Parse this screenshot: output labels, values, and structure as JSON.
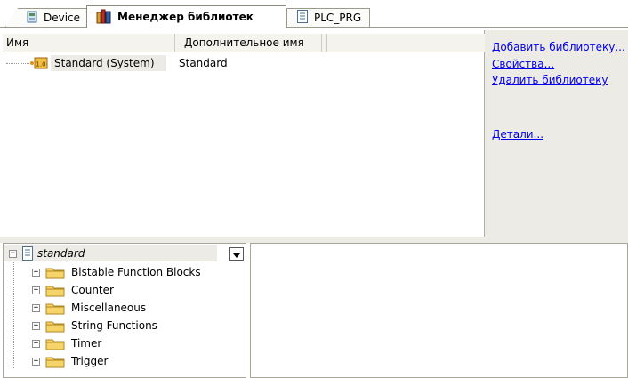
{
  "tabs": [
    {
      "label": "Device",
      "icon": "device-icon"
    },
    {
      "label": "Менеджер библиотек",
      "icon": "library-manager-icon"
    },
    {
      "label": "PLC_PRG",
      "icon": "document-icon"
    }
  ],
  "library_table": {
    "columns": [
      "Имя",
      "Дополнительное имя"
    ],
    "rows": [
      {
        "name": "Standard (System)",
        "alt_name": "Standard"
      }
    ]
  },
  "actions": {
    "add": "Добавить библиотеку...",
    "properties": "Свойства...",
    "delete": "Удалить библиотеку",
    "details": "Детали..."
  },
  "tree": {
    "root": "standard",
    "items": [
      "Bistable Function Blocks",
      "Counter",
      "Miscellaneous",
      "String Functions",
      "Timer",
      "Trigger"
    ]
  },
  "colors": {
    "link": "#0000ee",
    "panel_bg": "#ecebe6",
    "folder": "#f2c94c"
  }
}
